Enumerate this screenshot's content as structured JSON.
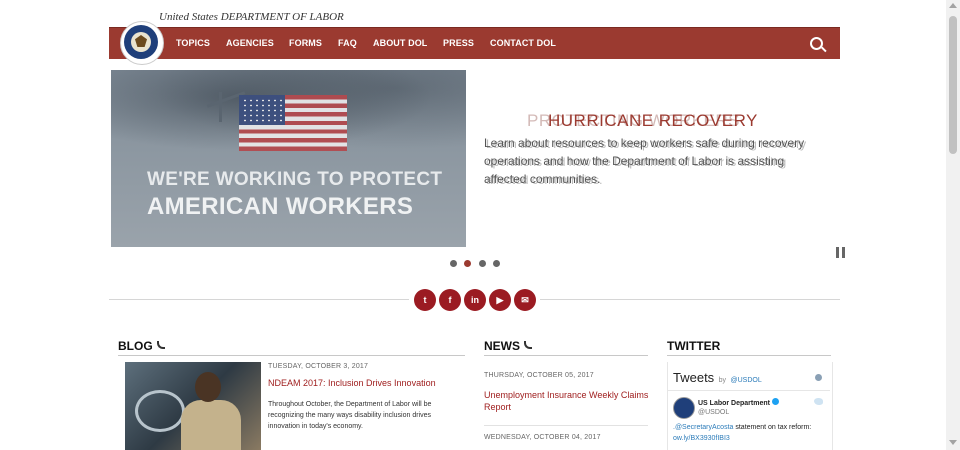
{
  "header": {
    "agency_text": "United States DEPARTMENT OF LABOR",
    "nav": [
      "TOPICS",
      "AGENCIES",
      "FORMS",
      "FAQ",
      "ABOUT DOL",
      "PRESS",
      "CONTACT DOL"
    ]
  },
  "hero": {
    "image_line1": "WE'RE WORKING TO PROTECT",
    "image_line2": "AMERICAN WORKERS",
    "slide_title": "HURRICANE RECOVERY",
    "slide_desc": "Learn about resources to keep workers safe during recovery operations and how the Department of Labor is assisting affected communities.",
    "ghost_title": "PROTECTING WORKERS",
    "ghost_desc": "Learn about resources to keep workers safe during recovery operations and how the Department of Labor is assisting affected communities.",
    "active_slide": 2,
    "slide_count": 4
  },
  "social": [
    "t",
    "f",
    "in",
    "▶",
    "✉"
  ],
  "blog": {
    "heading": "BLOG",
    "date": "TUESDAY, OCTOBER 3, 2017",
    "title": "NDEAM 2017: Inclusion Drives Innovation",
    "excerpt": "Throughout October, the Department of Labor will be recognizing the many ways disability inclusion drives innovation in today's economy."
  },
  "news": {
    "heading": "NEWS",
    "items": [
      {
        "date": "THURSDAY, OCTOBER 05, 2017",
        "title": "Unemployment Insurance Weekly Claims Report"
      },
      {
        "date": "WEDNESDAY, OCTOBER 04, 2017"
      }
    ]
  },
  "twitter": {
    "heading": "TWITTER",
    "widget_title": "Tweets",
    "by_prefix": "by",
    "by_handle": "@USDOL",
    "account_name": "US Labor Department",
    "account_handle": "@USDOL",
    "tweet_mention": ".@SecretaryAcosta",
    "tweet_text": " statement on tax reform:",
    "tweet_link": "ow.ly/BX3930fIBI3"
  },
  "colors": {
    "brand": "#9b3a30",
    "social": "#9b1b22",
    "link": "#a02020"
  }
}
